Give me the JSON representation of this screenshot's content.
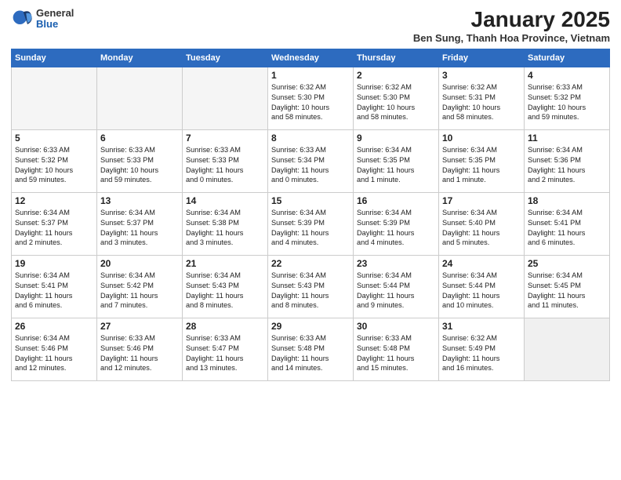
{
  "logo": {
    "general": "General",
    "blue": "Blue"
  },
  "title": "January 2025",
  "location": "Ben Sung, Thanh Hoa Province, Vietnam",
  "headers": [
    "Sunday",
    "Monday",
    "Tuesday",
    "Wednesday",
    "Thursday",
    "Friday",
    "Saturday"
  ],
  "weeks": [
    [
      {
        "day": "",
        "text": ""
      },
      {
        "day": "",
        "text": ""
      },
      {
        "day": "",
        "text": ""
      },
      {
        "day": "1",
        "text": "Sunrise: 6:32 AM\nSunset: 5:30 PM\nDaylight: 10 hours\nand 58 minutes."
      },
      {
        "day": "2",
        "text": "Sunrise: 6:32 AM\nSunset: 5:30 PM\nDaylight: 10 hours\nand 58 minutes."
      },
      {
        "day": "3",
        "text": "Sunrise: 6:32 AM\nSunset: 5:31 PM\nDaylight: 10 hours\nand 58 minutes."
      },
      {
        "day": "4",
        "text": "Sunrise: 6:33 AM\nSunset: 5:32 PM\nDaylight: 10 hours\nand 59 minutes."
      }
    ],
    [
      {
        "day": "5",
        "text": "Sunrise: 6:33 AM\nSunset: 5:32 PM\nDaylight: 10 hours\nand 59 minutes."
      },
      {
        "day": "6",
        "text": "Sunrise: 6:33 AM\nSunset: 5:33 PM\nDaylight: 10 hours\nand 59 minutes."
      },
      {
        "day": "7",
        "text": "Sunrise: 6:33 AM\nSunset: 5:33 PM\nDaylight: 11 hours\nand 0 minutes."
      },
      {
        "day": "8",
        "text": "Sunrise: 6:33 AM\nSunset: 5:34 PM\nDaylight: 11 hours\nand 0 minutes."
      },
      {
        "day": "9",
        "text": "Sunrise: 6:34 AM\nSunset: 5:35 PM\nDaylight: 11 hours\nand 1 minute."
      },
      {
        "day": "10",
        "text": "Sunrise: 6:34 AM\nSunset: 5:35 PM\nDaylight: 11 hours\nand 1 minute."
      },
      {
        "day": "11",
        "text": "Sunrise: 6:34 AM\nSunset: 5:36 PM\nDaylight: 11 hours\nand 2 minutes."
      }
    ],
    [
      {
        "day": "12",
        "text": "Sunrise: 6:34 AM\nSunset: 5:37 PM\nDaylight: 11 hours\nand 2 minutes."
      },
      {
        "day": "13",
        "text": "Sunrise: 6:34 AM\nSunset: 5:37 PM\nDaylight: 11 hours\nand 3 minutes."
      },
      {
        "day": "14",
        "text": "Sunrise: 6:34 AM\nSunset: 5:38 PM\nDaylight: 11 hours\nand 3 minutes."
      },
      {
        "day": "15",
        "text": "Sunrise: 6:34 AM\nSunset: 5:39 PM\nDaylight: 11 hours\nand 4 minutes."
      },
      {
        "day": "16",
        "text": "Sunrise: 6:34 AM\nSunset: 5:39 PM\nDaylight: 11 hours\nand 4 minutes."
      },
      {
        "day": "17",
        "text": "Sunrise: 6:34 AM\nSunset: 5:40 PM\nDaylight: 11 hours\nand 5 minutes."
      },
      {
        "day": "18",
        "text": "Sunrise: 6:34 AM\nSunset: 5:41 PM\nDaylight: 11 hours\nand 6 minutes."
      }
    ],
    [
      {
        "day": "19",
        "text": "Sunrise: 6:34 AM\nSunset: 5:41 PM\nDaylight: 11 hours\nand 6 minutes."
      },
      {
        "day": "20",
        "text": "Sunrise: 6:34 AM\nSunset: 5:42 PM\nDaylight: 11 hours\nand 7 minutes."
      },
      {
        "day": "21",
        "text": "Sunrise: 6:34 AM\nSunset: 5:43 PM\nDaylight: 11 hours\nand 8 minutes."
      },
      {
        "day": "22",
        "text": "Sunrise: 6:34 AM\nSunset: 5:43 PM\nDaylight: 11 hours\nand 8 minutes."
      },
      {
        "day": "23",
        "text": "Sunrise: 6:34 AM\nSunset: 5:44 PM\nDaylight: 11 hours\nand 9 minutes."
      },
      {
        "day": "24",
        "text": "Sunrise: 6:34 AM\nSunset: 5:44 PM\nDaylight: 11 hours\nand 10 minutes."
      },
      {
        "day": "25",
        "text": "Sunrise: 6:34 AM\nSunset: 5:45 PM\nDaylight: 11 hours\nand 11 minutes."
      }
    ],
    [
      {
        "day": "26",
        "text": "Sunrise: 6:34 AM\nSunset: 5:46 PM\nDaylight: 11 hours\nand 12 minutes."
      },
      {
        "day": "27",
        "text": "Sunrise: 6:33 AM\nSunset: 5:46 PM\nDaylight: 11 hours\nand 12 minutes."
      },
      {
        "day": "28",
        "text": "Sunrise: 6:33 AM\nSunset: 5:47 PM\nDaylight: 11 hours\nand 13 minutes."
      },
      {
        "day": "29",
        "text": "Sunrise: 6:33 AM\nSunset: 5:48 PM\nDaylight: 11 hours\nand 14 minutes."
      },
      {
        "day": "30",
        "text": "Sunrise: 6:33 AM\nSunset: 5:48 PM\nDaylight: 11 hours\nand 15 minutes."
      },
      {
        "day": "31",
        "text": "Sunrise: 6:32 AM\nSunset: 5:49 PM\nDaylight: 11 hours\nand 16 minutes."
      },
      {
        "day": "",
        "text": ""
      }
    ]
  ]
}
